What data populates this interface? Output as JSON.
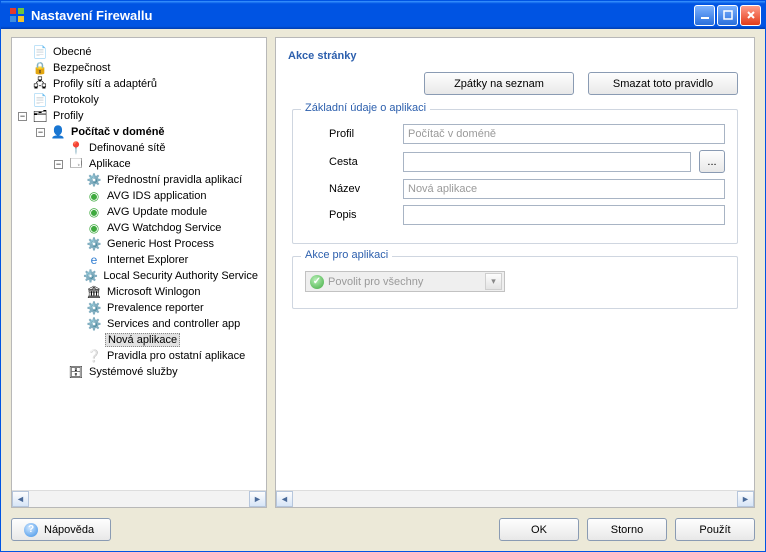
{
  "window": {
    "title": "Nastavení Firewallu"
  },
  "tree": {
    "n_obecne": "Obecné",
    "n_bezpecnost": "Bezpečnost",
    "n_profsit": "Profily sítí a adaptérů",
    "n_protokoly": "Protokoly",
    "n_profily": "Profily",
    "n_domena": "Počítač v doméně",
    "n_defsite": "Definované sítě",
    "n_aplikace": "Aplikace",
    "apps": [
      "Přednostní pravidla aplikací",
      "AVG IDS application",
      "AVG Update module",
      "AVG Watchdog Service",
      "Generic Host Process",
      "Internet Explorer",
      "Local Security Authority Service",
      "Microsoft Winlogon",
      "Prevalence reporter",
      "Services and controller app",
      "Nová aplikace",
      "Pravidla pro ostatní aplikace"
    ],
    "n_sluzby": "Systémové služby"
  },
  "page": {
    "title": "Akce stránky",
    "back": "Zpátky na seznam",
    "delete": "Smazat toto pravidlo",
    "group_basic": "Základní údaje o aplikaci",
    "labels": {
      "profil": "Profil",
      "cesta": "Cesta",
      "nazev": "Název",
      "popis": "Popis"
    },
    "profil_value": "Počítač v doméně",
    "nazev_placeholder": "Nová aplikace",
    "browse": "...",
    "group_action": "Akce pro aplikaci",
    "combo_value": "Povolit pro všechny"
  },
  "footer": {
    "help": "Nápověda",
    "ok": "OK",
    "cancel": "Storno",
    "apply": "Použít"
  }
}
